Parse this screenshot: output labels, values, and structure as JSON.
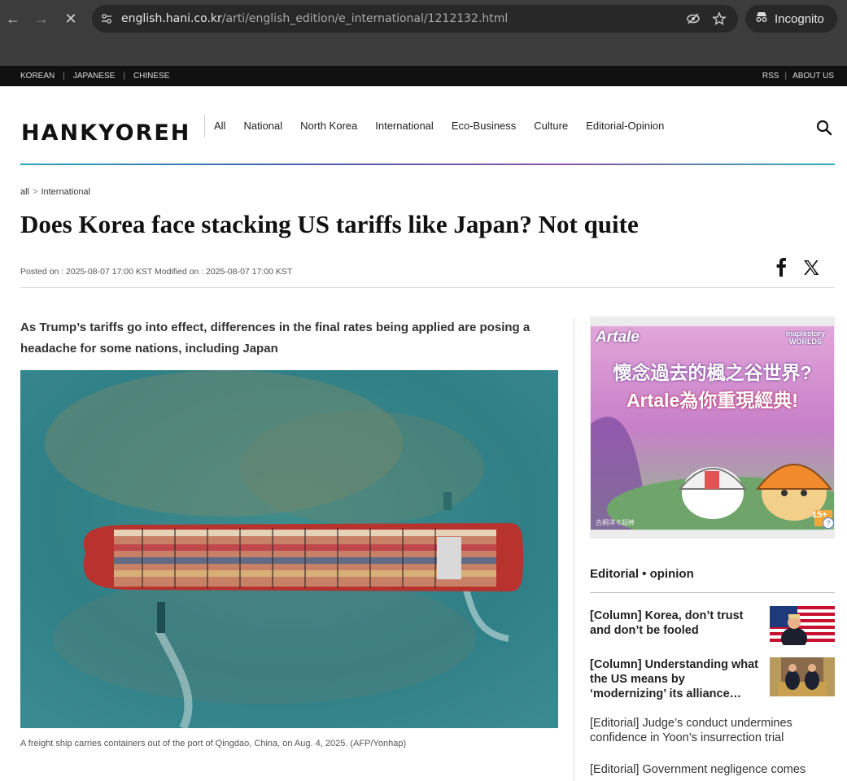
{
  "browser": {
    "url_host": "english.hani.co.kr",
    "url_path": "/arti/english_edition/e_international/1212132.html",
    "profile_label": "Incognito"
  },
  "topbar": {
    "languages": [
      "KOREAN",
      "JAPANESE",
      "CHINESE"
    ],
    "links": [
      "RSS",
      "ABOUT US"
    ]
  },
  "header": {
    "logo": "HANKYOREH",
    "nav": [
      "All",
      "National",
      "North Korea",
      "International",
      "Eco-Business",
      "Culture",
      "Editorial-Opinion"
    ]
  },
  "breadcrumb": {
    "root": "all",
    "section": "International"
  },
  "article": {
    "title": "Does Korea face stacking US tariffs like Japan? Not quite",
    "dates": "Posted on : 2025-08-07 17:00 KST Modified on : 2025-08-07 17:00 KST",
    "subtitle": "As Trump’s tariffs go into effect, differences in the final rates being applied are posing a headache for some nations, including Japan",
    "caption": "A freight ship carries containers out of the port of Qingdao, China, on Aug. 4, 2025. (AFP/Yonhap)"
  },
  "ad": {
    "brand": "Artale",
    "badge": "maplestory WORLDS",
    "headline_1": "懷念過去的楓之谷世界?",
    "headline_2": "Artale為你重現經典!",
    "rating": "15+",
    "fine_print": "古桐洋卡超棒"
  },
  "sidebar": {
    "section_title": "Editorial • opinion",
    "featured": [
      {
        "title": "[Column] Korea, don’t trust and don’t be fooled"
      },
      {
        "title": "[Column] Understanding what the US means by ‘modernizing’ its alliance…"
      }
    ],
    "list": [
      "[Editorial] Judge’s conduct undermines confidence in Yoon’s insurrection trial",
      "[Editorial] Government negligence comes"
    ]
  },
  "colors": {
    "accent_gradient": [
      "#2aa7b8",
      "#4a5fb0",
      "#8b55a8"
    ],
    "topbar_bg": "#111111",
    "chrome_bg": "#3c3c3c"
  },
  "icons": [
    "back-icon",
    "forward-icon",
    "stop-icon",
    "site-settings-icon",
    "eye-off-icon",
    "star-icon",
    "incognito-icon",
    "search-icon",
    "facebook-icon",
    "x-icon"
  ]
}
